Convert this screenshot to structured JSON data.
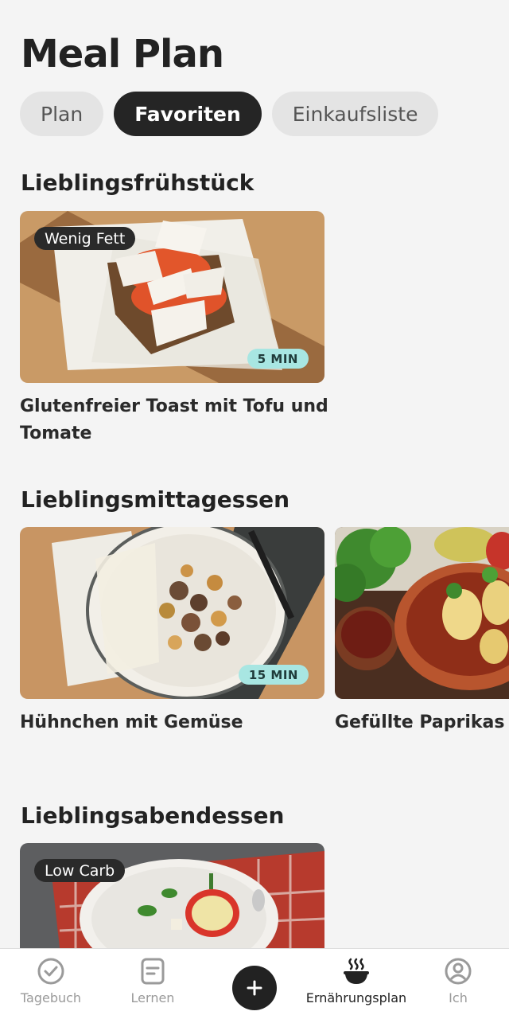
{
  "header": {
    "title": "Meal Plan"
  },
  "tabs": [
    {
      "label": "Plan",
      "active": false
    },
    {
      "label": "Favoriten",
      "active": true
    },
    {
      "label": "Einkaufsliste",
      "active": false
    }
  ],
  "sections": [
    {
      "title": "Lieblingsfrühstück",
      "cards": [
        {
          "badge": "Wenig Fett",
          "time": "5 MIN",
          "title": "Glutenfreier Toast mit Tofu und Tomate"
        }
      ]
    },
    {
      "title": "Lieblingsmittagessen",
      "cards": [
        {
          "time": "15 MIN",
          "title": "Hühnchen mit Gemüse"
        },
        {
          "title": "Gefüllte Paprikas"
        }
      ]
    },
    {
      "title": "Lieblingsabendessen",
      "cards": [
        {
          "badge": "Low Carb"
        }
      ]
    }
  ],
  "bottom_nav": [
    {
      "label": "Tagebuch",
      "icon": "check-circle-icon",
      "active": false
    },
    {
      "label": "Lernen",
      "icon": "document-icon",
      "active": false
    },
    {
      "label": "",
      "icon": "plus-icon",
      "active": false
    },
    {
      "label": "Ernährungsplan",
      "icon": "bowl-icon",
      "active": true
    },
    {
      "label": "Ich",
      "icon": "profile-icon",
      "active": false
    }
  ],
  "colors": {
    "accent_dark": "#252525",
    "time_badge": "#a8e6e2",
    "background": "#f4f4f4"
  }
}
